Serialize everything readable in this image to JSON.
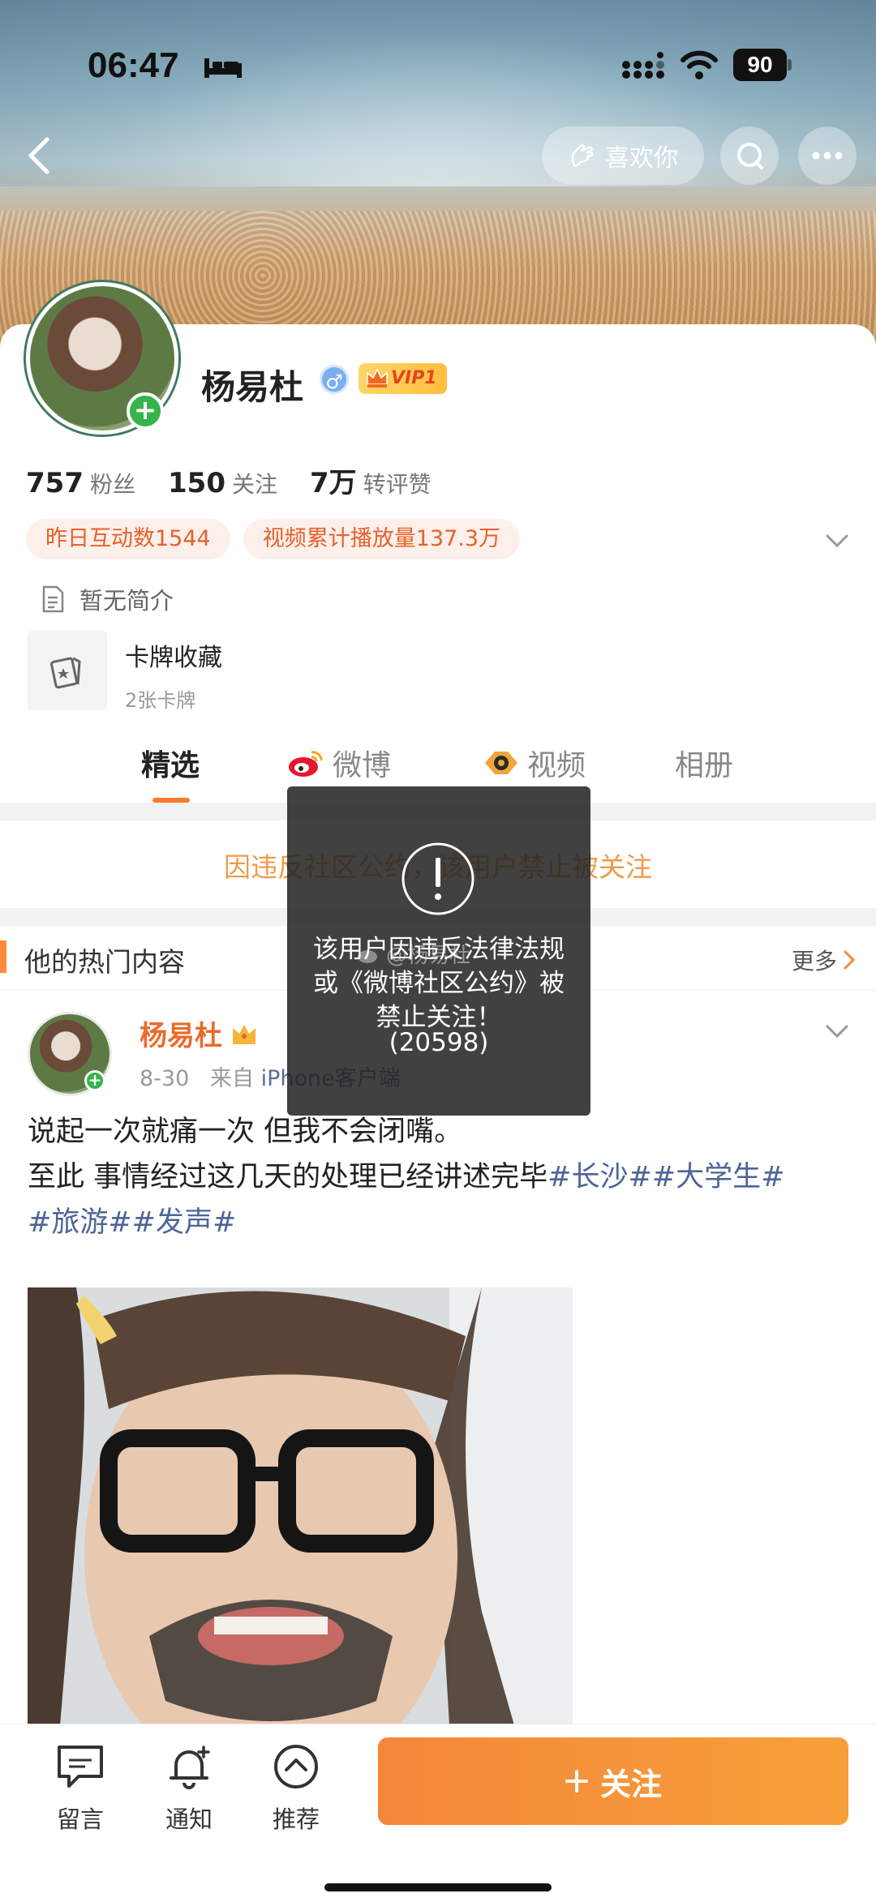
{
  "status_bar": {
    "time": "06:47",
    "battery": "90"
  },
  "header": {
    "like_label": "喜欢你"
  },
  "profile": {
    "name": "杨易杜",
    "vip_label": "VIP1",
    "stats": [
      {
        "num": "757",
        "label": "粉丝"
      },
      {
        "num": "150",
        "label": "关注"
      },
      {
        "num": "7万",
        "label": "转评赞"
      }
    ],
    "tags": [
      "昨日互动数1544",
      "视频累计播放量137.3万"
    ],
    "intro": "暂无简介",
    "collection": {
      "title": "卡牌收藏",
      "sub": "2张卡牌"
    }
  },
  "tabs": [
    {
      "label": "精选"
    },
    {
      "label": "微博"
    },
    {
      "label": "视频"
    },
    {
      "label": "相册"
    }
  ],
  "notice": "因违反社区公约，该用户禁止被关注",
  "hot": {
    "title": "他的热门内容",
    "more": "更多"
  },
  "post": {
    "author": "杨易杜",
    "date": "8-30",
    "from_prefix": "来自",
    "source": "iPhone客户端",
    "line1": "说起一次就痛一次 但我不会闭嘴。",
    "line2_text": "至此 事情经过这几天的处理已经讲述完毕",
    "tag1": "#长沙#",
    "tag2": "#大学生#",
    "tag3": "#旅游#",
    "tag4": "#发声#"
  },
  "toast": {
    "message": "该用户因违反法律法规或《微博社区公约》被禁止关注！",
    "code": "(20598)"
  },
  "watermark": "@杨易杜",
  "bottom_bar": {
    "comment": "留言",
    "notify": "通知",
    "recommend": "推荐",
    "follow": "关注"
  },
  "colors": {
    "accent": "#F4873A",
    "link": "#4D6597",
    "notice": "#F09A4A"
  }
}
